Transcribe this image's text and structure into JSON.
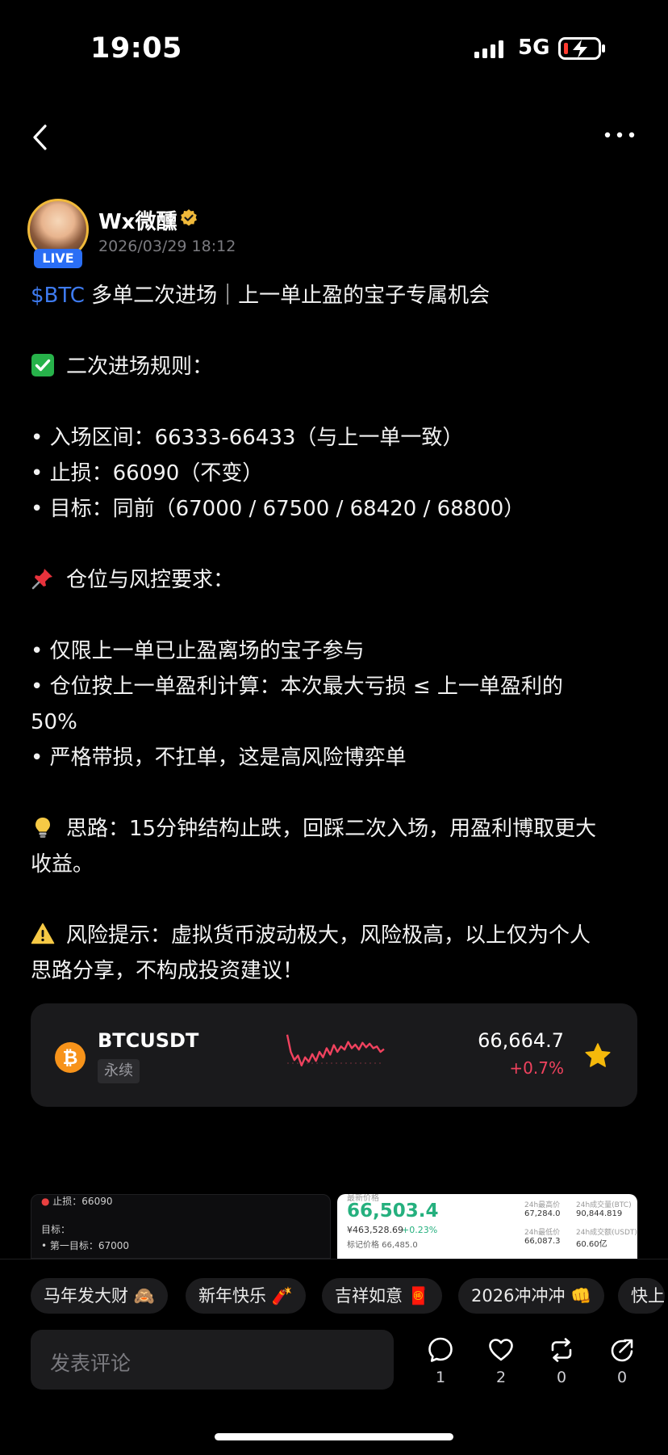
{
  "status_bar": {
    "time": "19:05",
    "network": "5G"
  },
  "post": {
    "author_name": "Wx微醺",
    "live_badge": "LIVE",
    "date": "2026/03/29 18:12",
    "ticker": "$BTC",
    "title": " 多单二次进场｜上一单止盈的宝子专属机会",
    "rules_heading": "二次进场规则：",
    "entry": "• 入场区间：66333-66433（与上一单一致）",
    "stop": "• 止损：66090（不变）",
    "target": "• 目标：同前（67000 / 67500 / 68420 / 68800）",
    "position_heading": "仓位与风控要求：",
    "req1": "• 仅限上一单已止盈离场的宝子参与",
    "req2_a": "• 仓位按上一单盈利计算：本次最大亏损 ≤ 上一单盈利的",
    "req2_b": "50%",
    "req3": "• 严格带损，不扛单，这是高风险博弈单",
    "idea_a": "思路：15分钟结构止跌，回踩二次入场，用盈利博取更大",
    "idea_b": "收益。",
    "risk_a": "风险提示：虚拟货币波动极大，风险极高，以上仅为个人",
    "risk_b": "思路分享，不构成投资建议！"
  },
  "market_card": {
    "pair": "BTCUSDT",
    "type": "永续",
    "price": "66,664.7",
    "change": "+0.7%",
    "sparkline": [
      0.88,
      0.5,
      0.32,
      0.42,
      0.2,
      0.38,
      0.28,
      0.45,
      0.3,
      0.5,
      0.38,
      0.58,
      0.44,
      0.65,
      0.5,
      0.62,
      0.55,
      0.72,
      0.58,
      0.66,
      0.55,
      0.7,
      0.6,
      0.68,
      0.58,
      0.62,
      0.5,
      0.56
    ]
  },
  "thumbnails": {
    "left": {
      "l1": "止损：66090",
      "l2": "目标：",
      "l3": "• 第一目标：67000"
    },
    "right": {
      "top_label": "最新价格",
      "price": "66,503.4",
      "cny": "¥463,528.69",
      "change": "+0.23%",
      "mark": "标记价格 66,485.0",
      "h_label": "24h最高价",
      "h_val": "67,284.0",
      "l_label": "24h最低价",
      "l_val": "66,087.3",
      "vb_label": "24h成交量(BTC)",
      "vb_val": "90,844.819",
      "vu_label": "24h成交额(USDT)",
      "vu_val": "60.60亿"
    }
  },
  "quick_replies": [
    "马年发大财 🙈",
    "新年快乐 🧨",
    "吉祥如意 🧧",
    "2026冲冲冲 👊",
    "快上"
  ],
  "comment": {
    "placeholder": "发表评论"
  },
  "actions": {
    "comments": "1",
    "likes": "2",
    "reposts": "0",
    "shares": "0"
  }
}
